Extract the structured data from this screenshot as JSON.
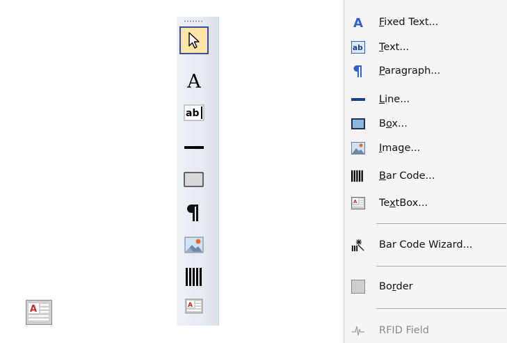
{
  "tool_palette": {
    "tools": [
      {
        "name": "pointer",
        "icon": "pointer-icon",
        "selected": true
      },
      {
        "name": "fixed-text",
        "icon": "fixed-text-icon",
        "selected": false
      },
      {
        "name": "text",
        "icon": "text-field-icon",
        "selected": false
      },
      {
        "name": "line",
        "icon": "line-icon",
        "selected": false
      },
      {
        "name": "box",
        "icon": "box-icon",
        "selected": false
      },
      {
        "name": "paragraph",
        "icon": "paragraph-icon",
        "selected": false
      },
      {
        "name": "image",
        "icon": "image-icon",
        "selected": false
      },
      {
        "name": "bar-code",
        "icon": "barcode-icon",
        "selected": false
      },
      {
        "name": "textbox",
        "icon": "textbox-icon",
        "selected": false
      }
    ],
    "selection_color": "#fde6a6",
    "selection_border": "#3b4f9b"
  },
  "menu": {
    "items": [
      {
        "label": "Fixed Text...",
        "mnemonic": "F",
        "icon": "fixed-text-icon",
        "enabled": true
      },
      {
        "label": "Text...",
        "mnemonic": "T",
        "icon": "text-field-icon",
        "enabled": true
      },
      {
        "label": "Paragraph...",
        "mnemonic": "P",
        "icon": "paragraph-icon",
        "enabled": true
      },
      {
        "label": "Line...",
        "mnemonic": "L",
        "icon": "line-icon",
        "enabled": true
      },
      {
        "label": "Box...",
        "mnemonic": "o",
        "icon": "box-icon",
        "enabled": true
      },
      {
        "label": "Image...",
        "mnemonic": "I",
        "icon": "image-icon",
        "enabled": true
      },
      {
        "label": "Bar Code...",
        "mnemonic": "B",
        "icon": "barcode-icon",
        "enabled": true
      },
      {
        "label": "TextBox...",
        "mnemonic": "x",
        "icon": "textbox-icon",
        "enabled": true
      },
      {
        "label": "Bar Code Wizard...",
        "mnemonic": "",
        "icon": "barcode-wizard-icon",
        "enabled": true
      },
      {
        "label": "Border",
        "mnemonic": "r",
        "icon": "border-icon",
        "enabled": true
      },
      {
        "label": "RFID Field",
        "mnemonic": "",
        "icon": "rfid-icon",
        "enabled": false
      }
    ],
    "accent_blue": "#2e62c8"
  }
}
